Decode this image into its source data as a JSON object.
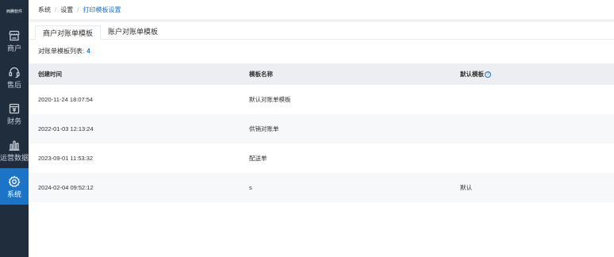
{
  "sidebar": {
    "logo_text": "西腾软件",
    "items": [
      {
        "label": "商户",
        "icon": "store-icon",
        "active": false
      },
      {
        "label": "售后",
        "icon": "headset-icon",
        "active": false
      },
      {
        "label": "财务",
        "icon": "finance-icon",
        "active": false
      },
      {
        "label": "运营数据",
        "icon": "bar-chart-icon",
        "active": false
      },
      {
        "label": "系统",
        "icon": "gear-icon",
        "active": true
      }
    ]
  },
  "breadcrumb": {
    "items": [
      "系统",
      "设置",
      "打印模板设置"
    ],
    "separator": "/"
  },
  "tabs": [
    "商户对账单模板",
    "账户对账单模板"
  ],
  "active_tab": 0,
  "list": {
    "label": "对账单模板列表:",
    "count": "4"
  },
  "table": {
    "headers": [
      "创建时间",
      "模板名称",
      "默认模板"
    ],
    "rows": [
      [
        "2020-11-24 18:07:54",
        "默认对账单模板",
        ""
      ],
      [
        "2022-01-03 12:13:24",
        "供销对账单",
        ""
      ],
      [
        "2023-09-01 11:53:32",
        "配送单",
        ""
      ],
      [
        "2024-02-04 09:52:12",
        "s",
        "默认"
      ]
    ]
  },
  "colors": {
    "sidebar_bg": "#1f2d3d",
    "accent": "#1b74c5",
    "header_bg": "#eceef1"
  }
}
